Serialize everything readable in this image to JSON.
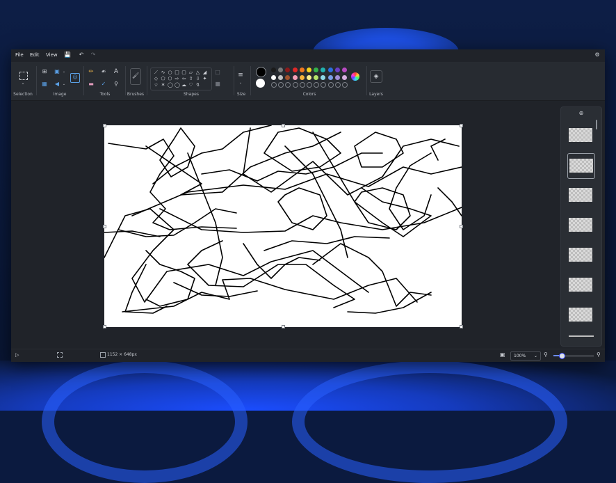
{
  "menu": {
    "file": "File",
    "edit": "Edit",
    "view": "View"
  },
  "ribbon": {
    "selection_label": "Selection",
    "image_label": "Image",
    "tools_label": "Tools",
    "brushes_label": "Brushes",
    "shapes_label": "Shapes",
    "size_label": "Size",
    "colors_label": "Colors",
    "layers_label": "Layers",
    "text_tool": "A"
  },
  "colors": {
    "primary": "#000000",
    "secondary": "#ffffff",
    "row1": [
      "#1b1b1b",
      "#7a7a7a",
      "#8b1a1a",
      "#e02828",
      "#f07a1e",
      "#f5d21e",
      "#34b34a",
      "#22b2b0",
      "#2b6fe0",
      "#6b3fc4",
      "#b84ac2"
    ],
    "row2": [
      "#ffffff",
      "#c2c2c2",
      "#a0522d",
      "#f3a0b8",
      "#f5b33a",
      "#f8ec8c",
      "#b5e36a",
      "#8fd9e8",
      "#7a9ee8",
      "#a18fd8",
      "#d8b0e0"
    ]
  },
  "status": {
    "canvas_size": "1152 × 648px",
    "zoom": "100%",
    "zoom_fraction": 0.2
  }
}
